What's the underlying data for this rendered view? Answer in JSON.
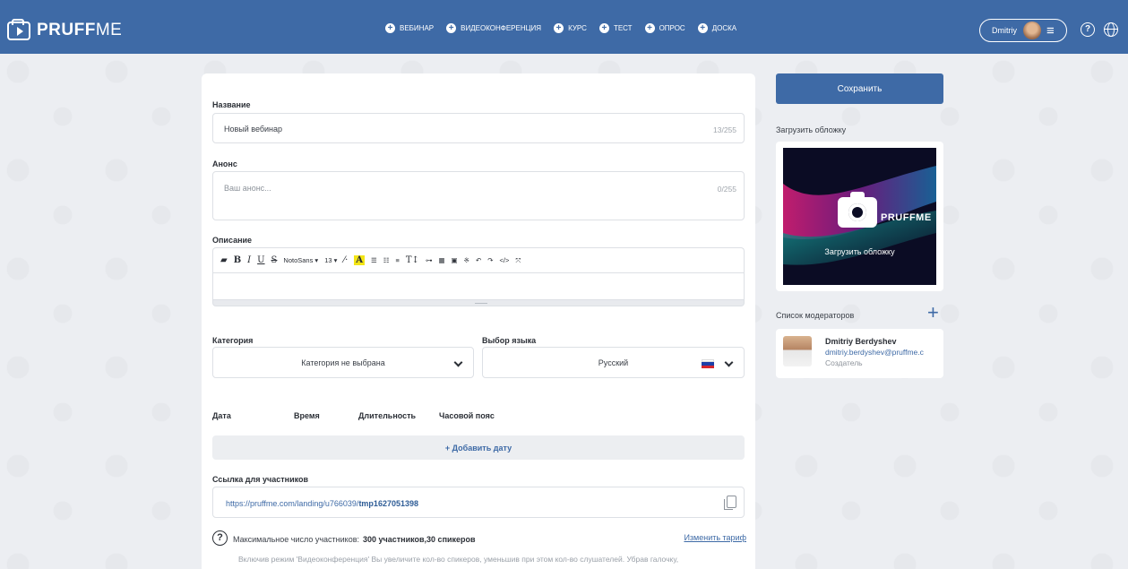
{
  "header": {
    "logo_bold": "PRUFF",
    "logo_light": "ME",
    "nav": [
      {
        "label": "ВЕБИНАР"
      },
      {
        "label": "ВИДЕОКОНФЕРЕНЦИЯ"
      },
      {
        "label": "КУРС"
      },
      {
        "label": "ТЕСТ"
      },
      {
        "label": "ОПРОС"
      },
      {
        "label": "ДОСКА"
      }
    ],
    "user_name": "Dmitriy",
    "menu_glyph": "≡",
    "help_glyph": "?"
  },
  "form": {
    "title_label": "Название",
    "title_value": "Новый вебинар",
    "title_counter": "13/255",
    "announce_label": "Анонс",
    "announce_placeholder": "Ваш анонс...",
    "announce_counter": "0/255",
    "description_label": "Описание",
    "toolbar": {
      "font_name": "NotoSans ▾",
      "font_size": "13 ▾"
    },
    "category_label": "Категория",
    "category_value": "Категория не выбрана",
    "language_label": "Выбор языка",
    "language_value": "Русский",
    "date_cols": [
      "Дата",
      "Время",
      "Длительность",
      "Часовой пояс"
    ],
    "add_date": "+ Добавить дату",
    "link_label": "Ссылка для участников",
    "link_base": "https://pruffme.com/landing/u766039/",
    "link_id": "tmp1627051398",
    "max_label": "Максимальное число участников:",
    "max_value": "300 участников,30 спикеров",
    "change_plan": "Изменить тариф",
    "note": "Включив режим 'Видеоконференция' Вы увеличите кол-во спикеров, уменьшив при этом кол-во слушателей. Убрав галочку,"
  },
  "sidebar": {
    "save_label": "Сохранить",
    "cover_label": "Загрузить обложку",
    "cover_brand": "PRUFFME",
    "cover_button_text": "Загрузить обложку",
    "moderators_label": "Список модераторов",
    "moderator": {
      "name": "Dmitriy Berdyshev",
      "email": "dmitriy.berdyshev@pruffme.c",
      "role": "Создатель"
    }
  },
  "colors": {
    "brand": "#3e6aa6",
    "background": "#eceef2"
  }
}
